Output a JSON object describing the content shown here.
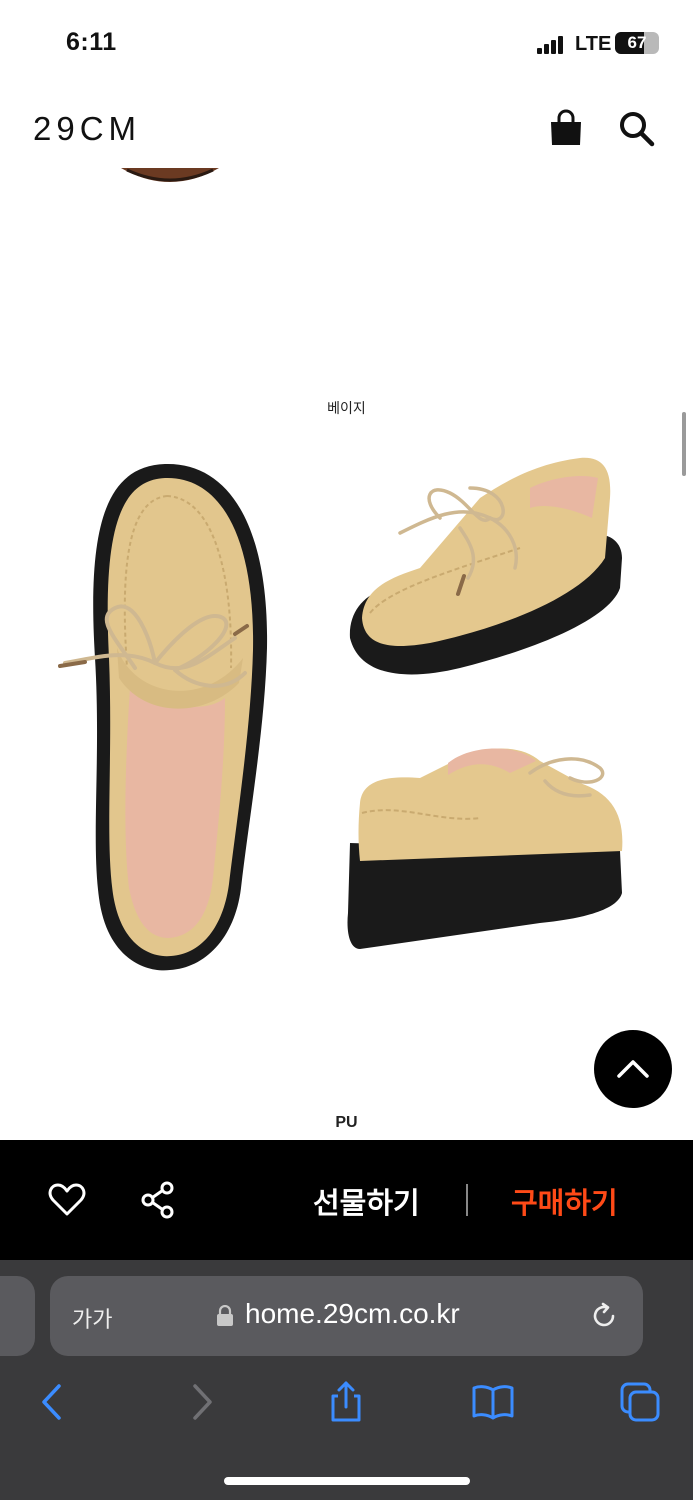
{
  "status_bar": {
    "time": "6:11",
    "network": "LTE",
    "battery": "67",
    "battery_level": 0.67
  },
  "header": {
    "logo": "29CM",
    "icons": [
      "shopping-bag-icon",
      "search-icon"
    ]
  },
  "product": {
    "color_option": "베이지",
    "material_label": "PU",
    "colors": {
      "suede": "#e4c88e",
      "sole": "#1a1a1a",
      "lining": "#e8b7a2"
    }
  },
  "buy_bar": {
    "gift_label": "선물하기",
    "buy_label": "구매하기",
    "buy_color": "#ff4a17",
    "icons": [
      "heart-icon",
      "share-icon"
    ]
  },
  "browser": {
    "text_size_label": "가가",
    "url": "home.29cm.co.kr",
    "icons": [
      "lock-icon",
      "reload-icon",
      "back-icon",
      "forward-icon",
      "share-icon",
      "bookmarks-icon",
      "tabs-icon"
    ]
  }
}
